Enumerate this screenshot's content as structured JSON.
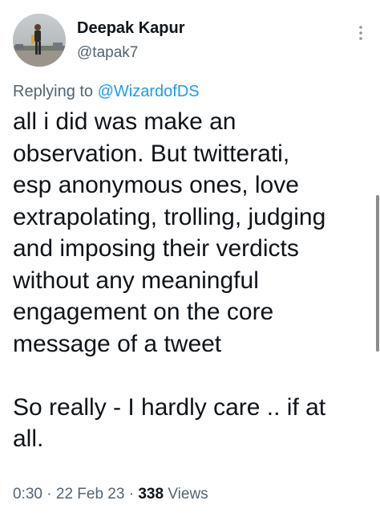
{
  "tweet": {
    "author_name": "Deepak Kapur",
    "author_handle": "@tapak7",
    "replying_prefix": "Replying to",
    "replying_to": "@WizardofDS",
    "text": "all i did was make an\nobservation. But twitterati,\nesp anonymous ones, love\nextrapolating, trolling, judging\nand imposing their verdicts\nwithout any meaningful\nengagement on the core\nmessage of a tweet\n\nSo really - I hardly care .. if at\nall.",
    "time": "0:30",
    "date": "22 Feb 23",
    "separator": "·",
    "views_count": "338",
    "views_label": "Views"
  },
  "icons": {
    "more": "more-vertical-icon",
    "avatar": "profile-photo"
  },
  "colors": {
    "text_primary": "#0f1419",
    "text_secondary": "#536471",
    "link": "#1d9bf0"
  }
}
